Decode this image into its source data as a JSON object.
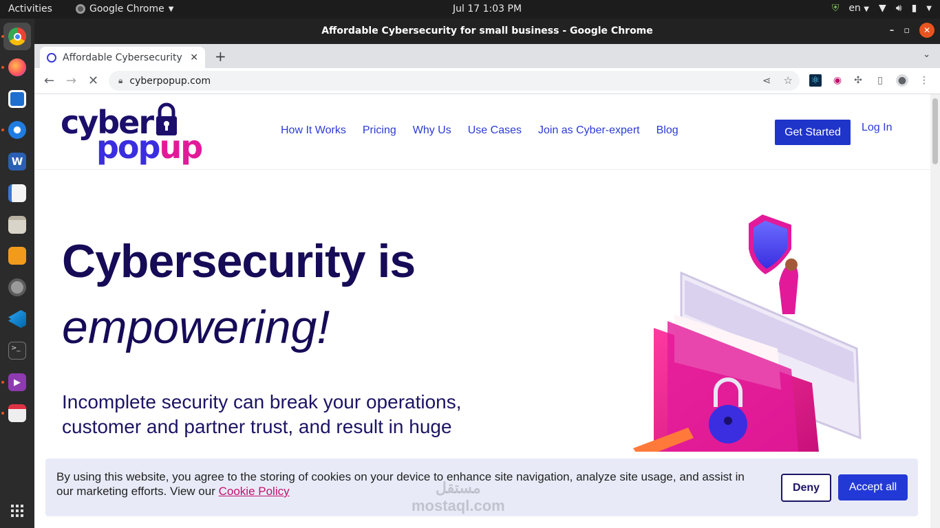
{
  "topbar": {
    "activities": "Activities",
    "app_name": "Google Chrome",
    "clock": "Jul 17   1:03 PM",
    "lang": "en"
  },
  "dock": {
    "items": [
      "chrome-icon",
      "firefox-icon",
      "text-editor-icon",
      "thunderbird-icon",
      "word-icon",
      "notes-icon",
      "files-icon",
      "app-store-icon",
      "settings-icon",
      "vscode-icon",
      "terminal-icon",
      "video-player-icon",
      "screenshot-icon",
      "app-grid-icon"
    ]
  },
  "window": {
    "title": "Affordable Cybersecurity for small business - Google Chrome"
  },
  "tab": {
    "title": "Affordable Cybersecurity"
  },
  "address": {
    "url": "cyberpopup.com"
  },
  "site": {
    "logo_line1": "cyber",
    "logo_pop": "pop",
    "logo_up": "up",
    "nav": [
      "How It Works",
      "Pricing",
      "Why Us",
      "Use Cases",
      "Join as Cyber-expert",
      "Blog"
    ],
    "cta": "Get Started",
    "login": "Log In"
  },
  "hero": {
    "headline1": "Cybersecurity is",
    "headline2": "empowering!",
    "paragraph": "Incomplete security can break your operations, customer and partner trust, and result in huge"
  },
  "cookie": {
    "text": "By using this website, you agree to the storing of cookies on your device to enhance site navigation, analyze site usage, and assist in our marketing efforts. View our",
    "policy_link": "Cookie Policy",
    "deny": "Deny",
    "accept": "Accept all"
  },
  "watermark": {
    "arabic": "مستقل",
    "latin": "mostaql.com"
  },
  "colors": {
    "brand_navy": "#160b57",
    "brand_blue": "#2339d6",
    "brand_pink": "#e21a9a",
    "ubuntu_orange": "#e95420"
  }
}
